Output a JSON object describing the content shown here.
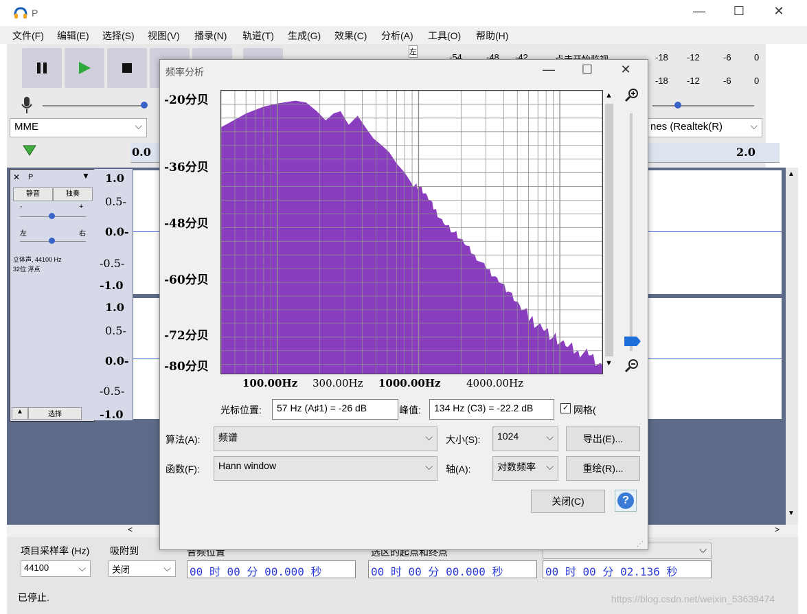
{
  "window": {
    "title": "P"
  },
  "menu": [
    "文件(F)",
    "编辑(E)",
    "选择(S)",
    "视图(V)",
    "播录(N)",
    "轨道(T)",
    "生成(G)",
    "效果(C)",
    "分析(A)",
    "工具(O)",
    "帮助(H)"
  ],
  "toolbar": {
    "host_combo": "MME",
    "device_combo": "nes (Realtek(R)",
    "meter_ticks": [
      "-54",
      "-48",
      "-42",
      "点击开始监视",
      "-18",
      "-12",
      "-6",
      "0"
    ],
    "meter_ticks_2": [
      "-18",
      "-12",
      "-6",
      "0"
    ],
    "rec_label": "左",
    "timeline_start": "0.0",
    "timeline_end": "2.0"
  },
  "track": {
    "name": "P",
    "mute_label": "静音",
    "solo_label": "独奏",
    "gain_minus": "-",
    "gain_plus": "+",
    "pan_left": "左",
    "pan_right": "右",
    "info_line1": "立体声, 44100 Hz",
    "info_line2": "32位 浮点",
    "select_label": "选择",
    "scale_top": [
      "1.0",
      "0.5-",
      "0.0-",
      "-0.5-",
      "-1.0"
    ],
    "scale_bottom": [
      "1.0",
      "0.5-",
      "0.0-",
      "-0.5-",
      "-1.0"
    ]
  },
  "bottom": {
    "rate_label": "项目采样率 (Hz)",
    "snap_label": "吸附到",
    "audio_pos_label": "音频位置",
    "selection_label": "选区的起点和终点",
    "rate_value": "44100",
    "snap_value": "关闭",
    "time1": "00 时 00 分 00.000 秒",
    "time2": "00 时 00 分 00.000 秒",
    "time3": "00 时 00 分 02.136 秒",
    "status": "已停止."
  },
  "dialog": {
    "title": "频率分析",
    "cursor_label": "光标位置:",
    "cursor_value": "57 Hz (A♯1) = -26 dB",
    "peak_label": "峰值:",
    "peak_value": "134 Hz (C3) = -22.2 dB",
    "grid_label": "网格(",
    "algo_label": "算法(A):",
    "algo_value": "频谱",
    "size_label": "大小(S):",
    "size_value": "1024",
    "export_button": "导出(E)...",
    "func_label": "函数(F):",
    "func_value": "Hann window",
    "axis_label": "轴(A):",
    "axis_value": "对数频率",
    "redraw_button": "重绘(R)...",
    "close_button": "关闭(C)",
    "help_icon_text": "?"
  },
  "chart_data": {
    "type": "area",
    "x_scale": "log",
    "fill_color": "#8a3dbf",
    "grid": true,
    "y_tick_labels": [
      "-20分贝",
      "-36分贝",
      "-48分贝",
      "-60分贝",
      "-72分贝",
      "-80分贝"
    ],
    "y_ticks": [
      -20,
      -36,
      -48,
      -60,
      -72,
      -80
    ],
    "x_tick_labels": [
      "100.00Hz",
      "300.00Hz",
      "1000.00Hz",
      "4000.00Hz"
    ],
    "x_ticks": [
      100,
      300,
      1000,
      4000
    ],
    "xlim": [
      40,
      20000
    ],
    "ylim": [
      -82,
      -20
    ],
    "x": [
      40,
      60,
      80,
      100,
      134,
      160,
      190,
      220,
      250,
      280,
      320,
      370,
      420,
      480,
      550,
      620,
      700,
      800,
      900,
      1000,
      1150,
      1300,
      1500,
      1800,
      2100,
      2500,
      3000,
      3600,
      4300,
      5200,
      6200,
      7500,
      9000,
      11000,
      13500,
      16000,
      20000
    ],
    "y": [
      -28,
      -25,
      -23.5,
      -22.8,
      -22.2,
      -22.6,
      -24.5,
      -26.5,
      -25,
      -24.5,
      -27.5,
      -25.5,
      -28,
      -30.5,
      -32,
      -33.5,
      -36,
      -38,
      -40.5,
      -41,
      -43,
      -46,
      -49,
      -51,
      -53.5,
      -56,
      -59,
      -61,
      -64,
      -67,
      -70,
      -72,
      -74,
      -76,
      -77,
      -78,
      -80
    ]
  },
  "watermark": "https://blog.csdn.net/weixin_53639474"
}
